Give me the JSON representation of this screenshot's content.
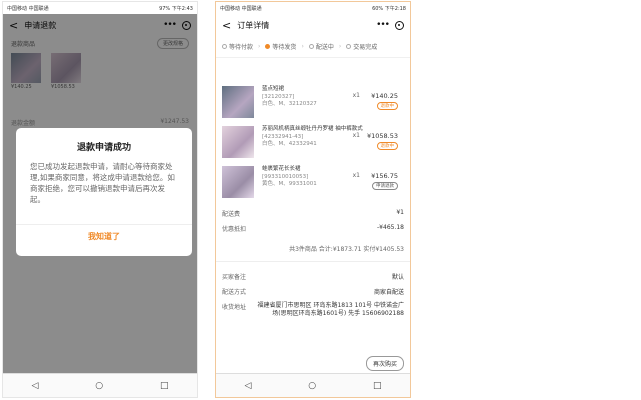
{
  "left": {
    "status": {
      "left": "中国移动 中国联通",
      "right": "97% 下午2:43"
    },
    "title": "申请退款",
    "section_label": "退款商品",
    "modify_btn": "更改规格",
    "thumbs": [
      {
        "price": "¥140.25"
      },
      {
        "price": "¥1058.53"
      }
    ],
    "bg_row_label": "退款金额",
    "bg_row_value": "¥1247.53",
    "modal": {
      "title": "退款申请成功",
      "body": "您已成功发起退款申请，请耐心等待商家处理,如果商家同意，将这成申请退款给您。如商家拒绝，您可以撤销退款申请后再次发起。",
      "button": "我知道了"
    },
    "nav": {
      "back": "◁",
      "home": "○",
      "recent": "□"
    }
  },
  "right": {
    "status": {
      "left": "中国移动 中国联通",
      "right": "60% 下午2:18"
    },
    "title": "订单详情",
    "steps": [
      "等待付款",
      "等待发货",
      "配送中",
      "交易完成"
    ],
    "items": [
      {
        "name": "蓝点短裙",
        "code": "[32120327]",
        "spec": "白色、M、32120327",
        "qty": "x1",
        "price": "¥140.25",
        "tag": "退款中"
      },
      {
        "name": "苏丽风机柄真丝缎牡丹丹罗裙 袖中裤款式",
        "code": "[42332941-43]",
        "spec": "白色、M、42332941",
        "qty": "x1",
        "price": "¥1058.53",
        "tag": "退款中"
      },
      {
        "name": "蛙裹繁花长长裙",
        "code": "[993310010053]",
        "spec": "黄色、M、99331001",
        "qty": "x1",
        "price": "¥156.75",
        "tag": "申请退款"
      }
    ],
    "shipping": {
      "label": "配送费",
      "value": "¥1"
    },
    "discount": {
      "label": "优惠抵扣",
      "value": "-¥465.18"
    },
    "summary": "共3件商品 合计:¥1873.71 实付¥1405.53",
    "remark": {
      "label": "买家备注",
      "value": "默认"
    },
    "delivery": {
      "label": "配送方式",
      "value": "商家自配送"
    },
    "address": {
      "label": "收货地址",
      "value": "福建省厦门市思明区 环岛东路1813 101号 中铁诺金广场(思明区环岛东路1601号) 先手 15606902188"
    },
    "buy_again": "再次购买",
    "nav": {
      "back": "◁",
      "home": "○",
      "recent": "□"
    }
  }
}
